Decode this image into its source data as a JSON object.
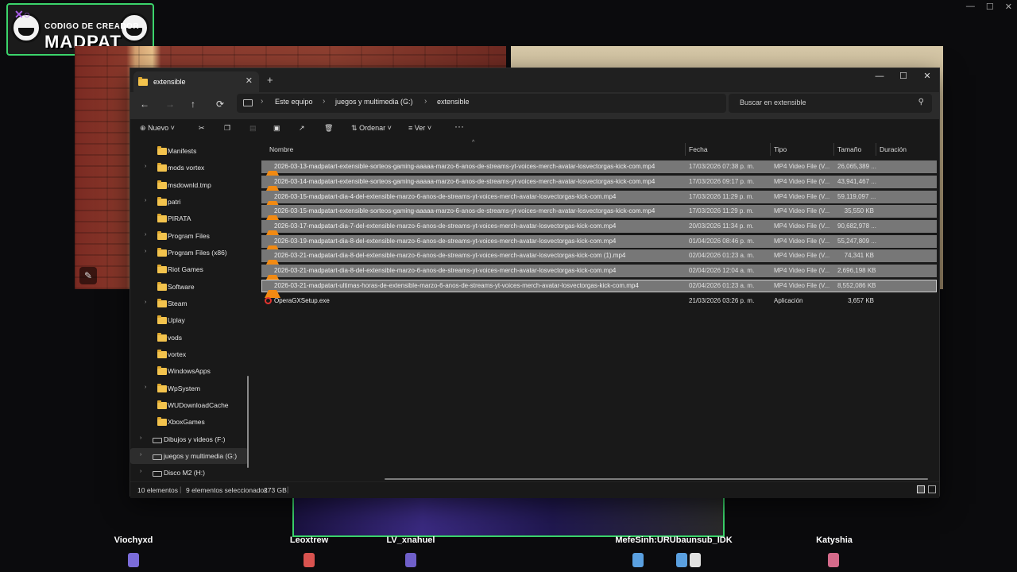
{
  "overlay": {
    "logo_top": "CODIGO DE CREADOR",
    "logo_main": "MADPAT",
    "viewers": [
      {
        "name": "Viochyxd",
        "color": "#7b6cd9"
      },
      {
        "name": "Leoxtrew",
        "color": "#d9534f"
      },
      {
        "name": "LV_xnahuel",
        "color": "#6f5fc9"
      },
      {
        "name": "MefeSinh:URUbaunsub_IDK",
        "color": "#5aa0e0"
      },
      {
        "name": "Katyshia",
        "color": "#d46a8a"
      }
    ]
  },
  "explorer": {
    "tab_title": "extensible",
    "tab_close_icon": "close-icon",
    "new_tab_icon": "plus-icon",
    "window_controls": {
      "minimize": "—",
      "maximize": "☐",
      "close": "✕"
    },
    "nav": {
      "back": "←",
      "forward": "→",
      "up": "↑",
      "refresh": "⟳"
    },
    "breadcrumb": [
      "Este equipo",
      "juegos y multimedia (G:)",
      "extensible"
    ],
    "search_placeholder": "Buscar en extensible",
    "toolbar": {
      "new_label": "Nuevo",
      "sort_label": "Ordenar",
      "view_label": "Ver",
      "more": "···"
    },
    "sidebar": [
      {
        "label": "Manifests",
        "chevron": false
      },
      {
        "label": "mods vortex",
        "chevron": true
      },
      {
        "label": "msdownld.tmp",
        "chevron": false
      },
      {
        "label": "patri",
        "chevron": true
      },
      {
        "label": "PIRATA",
        "chevron": false
      },
      {
        "label": "Program Files",
        "chevron": true
      },
      {
        "label": "Program Files (x86)",
        "chevron": true
      },
      {
        "label": "Riot Games",
        "chevron": false
      },
      {
        "label": "Software",
        "chevron": false
      },
      {
        "label": "Steam",
        "chevron": true
      },
      {
        "label": "Uplay",
        "chevron": false
      },
      {
        "label": "vods",
        "chevron": false
      },
      {
        "label": "vortex",
        "chevron": false
      },
      {
        "label": "WindowsApps",
        "chevron": false
      },
      {
        "label": "WpSystem",
        "chevron": true
      },
      {
        "label": "WUDownloadCache",
        "chevron": false
      },
      {
        "label": "XboxGames",
        "chevron": false
      }
    ],
    "drives": [
      {
        "label": "Dibujos y videos (F:)",
        "selected": false
      },
      {
        "label": "juegos y multimedia (G:)",
        "selected": true
      },
      {
        "label": "Disco M2 (H:)",
        "selected": false
      }
    ],
    "columns": {
      "name": "Nombre",
      "date": "Fecha",
      "type": "Tipo",
      "size": "Tamaño",
      "duration": "Duración"
    },
    "files": [
      {
        "name": "2026-03-13-madpatart-extensible-sorteos-gaming-aaaaa-marzo-6-anos-de-streams-yt-voices-merch-avatar-losvectorgas-kick-com.mp4",
        "date": "17/03/2026 07:38 p. m.",
        "type": "MP4 Video File (V...",
        "size": "26,065,389 ...",
        "icon": "vlc-icon",
        "selected": true
      },
      {
        "name": "2026-03-14-madpatart-extensible-sorteos-gaming-aaaaa-marzo-6-anos-de-streams-yt-voices-merch-avatar-losvectorgas-kick-com.mp4",
        "date": "17/03/2026 09:17 p. m.",
        "type": "MP4 Video File (V...",
        "size": "43,941,467 ...",
        "icon": "vlc-icon",
        "selected": true
      },
      {
        "name": "2026-03-15-madpatart-dia-4-del-extensible-marzo-6-anos-de-streams-yt-voices-merch-avatar-losvectorgas-kick-com.mp4",
        "date": "17/03/2026 11:29 p. m.",
        "type": "MP4 Video File (V...",
        "size": "59,119,097 ...",
        "icon": "vlc-icon",
        "selected": true
      },
      {
        "name": "2026-03-15-madpatart-extensible-sorteos-gaming-aaaaa-marzo-6-anos-de-streams-yt-voices-merch-avatar-losvectorgas-kick-com.mp4",
        "date": "17/03/2026 11:29 p. m.",
        "type": "MP4 Video File (V...",
        "size": "35,550 KB",
        "icon": "vlc-icon",
        "selected": true
      },
      {
        "name": "2026-03-17-madpatart-dia-7-del-extensible-marzo-6-anos-de-streams-yt-voices-merch-avatar-losvectorgas-kick-com.mp4",
        "date": "20/03/2026 11:34 p. m.",
        "type": "MP4 Video File (V...",
        "size": "90,682,978 ...",
        "icon": "vlc-icon",
        "selected": true
      },
      {
        "name": "2026-03-19-madpatart-dia-8-del-extensible-marzo-6-anos-de-streams-yt-voices-merch-avatar-losvectorgas-kick-com.mp4",
        "date": "01/04/2026 08:46 p. m.",
        "type": "MP4 Video File (V...",
        "size": "55,247,809 ...",
        "icon": "vlc-icon",
        "selected": true
      },
      {
        "name": "2026-03-21-madpatart-dia-8-del-extensible-marzo-6-anos-de-streams-yt-voices-merch-avatar-losvectorgas-kick-com (1).mp4",
        "date": "02/04/2026 01:23 a. m.",
        "type": "MP4 Video File (V...",
        "size": "74,341 KB",
        "icon": "vlc-icon",
        "selected": true
      },
      {
        "name": "2026-03-21-madpatart-dia-8-del-extensible-marzo-6-anos-de-streams-yt-voices-merch-avatar-losvectorgas-kick-com.mp4",
        "date": "02/04/2026 12:04 a. m.",
        "type": "MP4 Video File (V...",
        "size": "2,696,198 KB",
        "icon": "vlc-icon",
        "selected": true
      },
      {
        "name": "2026-03-21-madpatart-ultimas-horas-de-extensible-marzo-6-anos-de-streams-yt-voices-merch-avatar-losvectorgas-kick-com.mp4",
        "date": "02/04/2026 01:23 a. m.",
        "type": "MP4 Video File (V...",
        "size": "8,552,086 KB",
        "icon": "vlc-icon",
        "selected": true
      },
      {
        "name": "OperaGXSetup.exe",
        "date": "21/03/2026 03:26 p. m.",
        "type": "Aplicación",
        "size": "3,657 KB",
        "icon": "opera-icon",
        "selected": false
      }
    ],
    "status": {
      "count": "10 elementos",
      "selected": "9 elementos seleccionados",
      "size": "273 GB"
    },
    "colors": {
      "accent_folder": "#f3c34d",
      "selection": "#777777",
      "vlc": "#f28a12",
      "opera": "#e3342f"
    }
  }
}
